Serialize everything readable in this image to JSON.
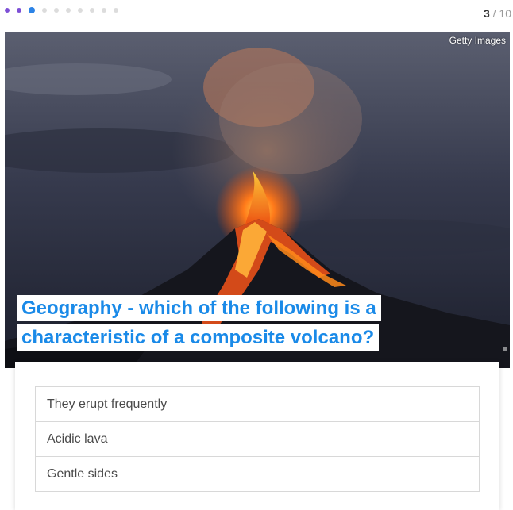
{
  "progress": {
    "current": "3",
    "separator": "/",
    "total": "10",
    "dots": [
      {
        "state": "done"
      },
      {
        "state": "done"
      },
      {
        "state": "current"
      },
      {
        "state": "pending"
      },
      {
        "state": "pending"
      },
      {
        "state": "pending"
      },
      {
        "state": "pending"
      },
      {
        "state": "pending"
      },
      {
        "state": "pending"
      },
      {
        "state": "pending"
      }
    ]
  },
  "hero": {
    "credit": "Getty Images",
    "question": "Geography - which of the following is a characteristic of a composite volcano?"
  },
  "answers": [
    {
      "label": "They erupt frequently"
    },
    {
      "label": "Acidic lava"
    },
    {
      "label": "Gentle sides"
    }
  ],
  "colors": {
    "accent": "#2c83e6",
    "question_text": "#1a8ae8",
    "dot_done": "#7d4fd6",
    "dot_pending": "#dcdcdc"
  }
}
